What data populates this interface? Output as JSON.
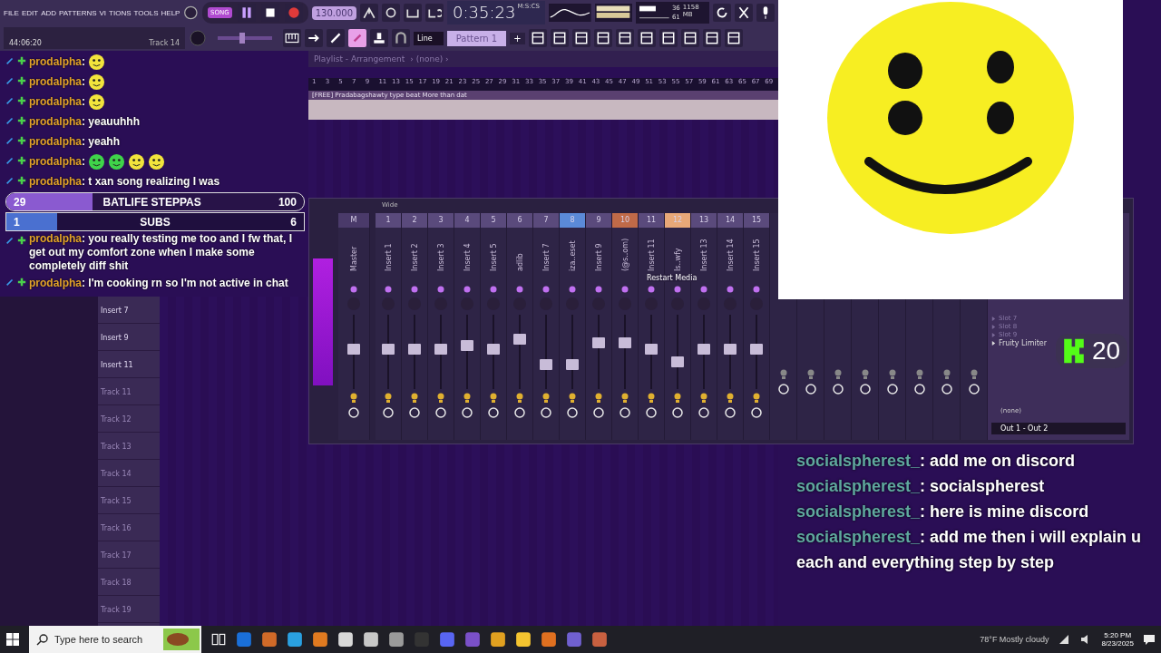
{
  "menu": [
    "FILE",
    "EDIT",
    "ADD",
    "PATTERNS",
    "VI",
    "TIONS",
    "TOOLS",
    "HELP"
  ],
  "chat_separator": ":",
  "toolbar": {
    "master_volume": {
      "level": 0.45
    },
    "mode": "SONG",
    "tempo": "130.000",
    "time": "0:35:23",
    "time_unit": "M:S:CS",
    "cpu": "36",
    "memory": "1158 MB",
    "polyphony": "61",
    "hint_time": "44:06:20",
    "hint_track": "Track 14",
    "snap": "Line",
    "pattern": "Pattern 1",
    "pattern_add": "+"
  },
  "playlist": {
    "title": "Playlist - Arrangement",
    "breadcrumb": "› (none) ›",
    "ruler": [
      "1",
      "3",
      "5",
      "7",
      "9",
      "11",
      "13",
      "15",
      "17",
      "19",
      "21",
      "23",
      "25",
      "27",
      "29",
      "31",
      "33",
      "35",
      "37",
      "39",
      "41",
      "43",
      "45",
      "47",
      "49",
      "51",
      "53",
      "55",
      "57",
      "59",
      "61",
      "63",
      "65",
      "67",
      "69"
    ],
    "clip": "[FREE] Pradabagshawty type beat More than dat",
    "tracks": [
      "Insert 7",
      "Insert 9",
      "Insert 11",
      "Track 11",
      "Track 12",
      "Track 13",
      "Track 14",
      "Track 15",
      "Track 16",
      "Track 17",
      "Track 18",
      "Track 19"
    ]
  },
  "chat": [
    {
      "kind": "emotes",
      "user": "prodalpha",
      "emotes": [
        {
          "color": "#f2e43c"
        }
      ]
    },
    {
      "kind": "emotes",
      "user": "prodalpha",
      "emotes": [
        {
          "color": "#f2e43c"
        }
      ]
    },
    {
      "kind": "emotes",
      "user": "prodalpha",
      "emotes": [
        {
          "color": "#f2e43c"
        }
      ]
    },
    {
      "kind": "text",
      "user": "prodalpha",
      "text": "yeauuhhh"
    },
    {
      "kind": "text",
      "user": "prodalpha",
      "text": "yeahh"
    },
    {
      "kind": "emotes",
      "user": "prodalpha",
      "emotes": [
        {
          "color": "#3fd44a"
        },
        {
          "color": "#3fd44a"
        },
        {
          "color": "#f2e43c"
        },
        {
          "color": "#f2e43c"
        }
      ]
    },
    {
      "kind": "text",
      "user": "prodalpha",
      "text": "t xan song realizing I was"
    },
    {
      "kind": "goal",
      "label": "BATLIFE STEPPAS",
      "current": "29",
      "target": "100",
      "level": 0.29
    },
    {
      "kind": "goal",
      "label": "SUBS",
      "current": "1",
      "target": "6",
      "level": 0.17
    },
    {
      "kind": "text",
      "user": "prodalpha",
      "text": "you really testing me too and I fw that, I get out my comfort zone when I make some completely diff shit"
    },
    {
      "kind": "text",
      "user": "prodalpha",
      "text": "I'm cooking rn so I'm not active in chat"
    }
  ],
  "mixer": {
    "title": "Wide",
    "tooltip": "Restart Media",
    "channels": [
      {
        "number": "M",
        "name": "Master",
        "color": "#4a3a6a",
        "level": 0.55
      },
      {
        "number": "1",
        "name": "Insert 1",
        "color": "#5a4a7c",
        "level": 0.55
      },
      {
        "number": "2",
        "name": "Insert 2",
        "color": "#5a4a7c",
        "level": 0.55
      },
      {
        "number": "3",
        "name": "Insert 3",
        "color": "#5a4a7c",
        "level": 0.55
      },
      {
        "number": "4",
        "name": "Insert 4",
        "color": "#5a4a7c",
        "level": 0.6
      },
      {
        "number": "5",
        "name": "Insert 5",
        "color": "#5a4a7c",
        "level": 0.55
      },
      {
        "number": "6",
        "name": "adlib",
        "color": "#5a4a7c",
        "level": 0.7
      },
      {
        "number": "7",
        "name": "Insert 7",
        "color": "#5a4a7c",
        "level": 0.3
      },
      {
        "number": "8",
        "name": "iza..eset",
        "color": "#5b8ad8",
        "level": 0.3
      },
      {
        "number": "9",
        "name": "Insert 9",
        "color": "#5a4a7c",
        "level": 0.65
      },
      {
        "number": "10",
        "name": "(@s..om)",
        "color": "#c06a48",
        "level": 0.65
      },
      {
        "number": "11",
        "name": "Insert 11",
        "color": "#5a4a7c",
        "level": 0.55
      },
      {
        "number": "12",
        "name": "Is..wfy",
        "color": "#e8a878",
        "level": 0.35
      },
      {
        "number": "13",
        "name": "Insert 13",
        "color": "#5a4a7c",
        "level": 0.55
      },
      {
        "number": "14",
        "name": "Insert 14",
        "color": "#5a4a7c",
        "level": 0.55
      },
      {
        "number": "15",
        "name": "Insert 15",
        "color": "#5a4a7c",
        "level": 0.55
      }
    ],
    "slots": [
      "Slot 7",
      "Slot 8",
      "Slot 9"
    ],
    "effect": "Fruity Limiter",
    "input": "(none)",
    "output": "Out 1 - Out 2"
  },
  "kick_badge": {
    "count": "20"
  },
  "stream_chat_separator": ":",
  "stream_chat": [
    {
      "user": "socialspherest_",
      "text": "add me on discord"
    },
    {
      "user": "socialspherest_",
      "text": "socialspherest"
    },
    {
      "user": "socialspherest_",
      "text": "here is mine discord"
    },
    {
      "user": "socialspherest_",
      "text": "add me then i will explain u each and everything step by step"
    }
  ],
  "taskbar": {
    "search_placeholder": "Type here to search",
    "weather": "78°F Mostly cloudy",
    "time": "5:20 PM",
    "date": "8/23/2025"
  }
}
